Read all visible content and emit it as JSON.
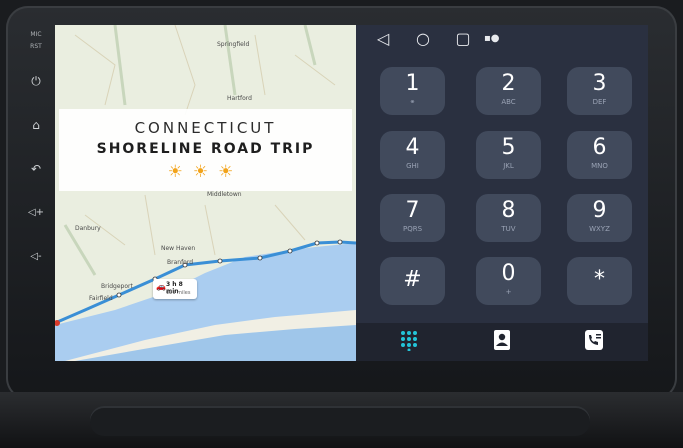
{
  "device": {
    "left_rail": [
      {
        "name": "mic-label",
        "text": "MIC"
      },
      {
        "name": "rst-label",
        "text": "RST"
      },
      {
        "name": "power-icon",
        "icon": "power",
        "glyph": "⏻"
      },
      {
        "name": "home-icon",
        "icon": "home",
        "glyph": "⌂"
      },
      {
        "name": "back-icon",
        "icon": "back",
        "glyph": "↶"
      },
      {
        "name": "volume-up-icon",
        "icon": "volume-up",
        "glyph": "◁+"
      },
      {
        "name": "volume-down-icon",
        "icon": "volume-down",
        "glyph": "◁-"
      }
    ]
  },
  "map": {
    "towns": {
      "springfield": "Springfield",
      "hartford": "Hartford",
      "middletown": "Middletown",
      "danbury": "Danbury",
      "new_haven": "New Haven",
      "branford": "Branford",
      "bridgeport": "Bridgeport",
      "fairfield": "Fairfield"
    },
    "banner": {
      "title": "CONNECTICUT",
      "subtitle": "SHORELINE ROAD TRIP",
      "suns": "☀☀☀"
    },
    "route_chip": {
      "time": "3 h 8 min",
      "distance": "121 miles"
    }
  },
  "phone": {
    "navbar": {
      "back": "◁",
      "home": "○",
      "recents": "▢",
      "status": "▪●"
    },
    "keypad": [
      {
        "digit": "1",
        "sub": "⚭"
      },
      {
        "digit": "2",
        "sub": "ABC"
      },
      {
        "digit": "3",
        "sub": "DEF"
      },
      {
        "digit": "4",
        "sub": "GHI"
      },
      {
        "digit": "5",
        "sub": "JKL"
      },
      {
        "digit": "6",
        "sub": "MNO"
      },
      {
        "digit": "7",
        "sub": "PQRS"
      },
      {
        "digit": "8",
        "sub": "TUV"
      },
      {
        "digit": "9",
        "sub": "WXYZ"
      },
      {
        "digit": "#",
        "sub": ""
      },
      {
        "digit": "0",
        "sub": "+"
      },
      {
        "digit": "*",
        "sub": ""
      }
    ],
    "tabs": [
      {
        "name": "tab-dialpad",
        "icon": "dialpad-icon",
        "active": true
      },
      {
        "name": "tab-contacts",
        "icon": "contacts-icon",
        "active": false
      },
      {
        "name": "tab-call-log",
        "icon": "call-log-icon",
        "active": false
      }
    ],
    "colors": {
      "accent": "#23c4d8",
      "key": "#414a5c",
      "panel": "#2a3040"
    }
  }
}
